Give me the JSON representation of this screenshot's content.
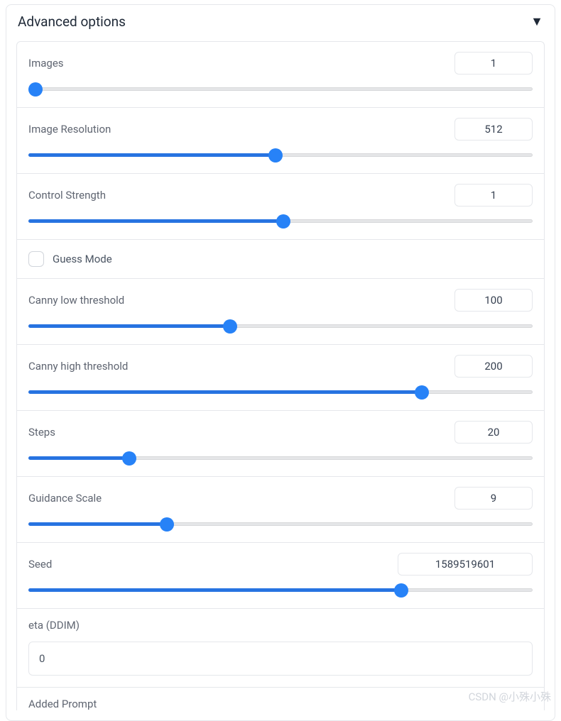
{
  "header": {
    "title": "Advanced options"
  },
  "sliders": {
    "images": {
      "label": "Images",
      "value": "1",
      "fillPct": 0
    },
    "resolution": {
      "label": "Image Resolution",
      "value": "512",
      "fillPct": 49
    },
    "strength": {
      "label": "Control Strength",
      "value": "1",
      "fillPct": 50.5
    },
    "canny_low": {
      "label": "Canny low threshold",
      "value": "100",
      "fillPct": 40
    },
    "canny_high": {
      "label": "Canny high threshold",
      "value": "200",
      "fillPct": 78
    },
    "steps": {
      "label": "Steps",
      "value": "20",
      "fillPct": 20
    },
    "guidance": {
      "label": "Guidance Scale",
      "value": "9",
      "fillPct": 27.5
    },
    "seed": {
      "label": "Seed",
      "value": "1589519601",
      "fillPct": 74
    }
  },
  "checkbox": {
    "guess_mode": {
      "label": "Guess Mode",
      "checked": false
    }
  },
  "textInputs": {
    "eta": {
      "label": "eta (DDIM)",
      "value": "0"
    }
  },
  "prompt": {
    "label": "Added Prompt"
  },
  "watermark": "CSDN @小殊小殊"
}
